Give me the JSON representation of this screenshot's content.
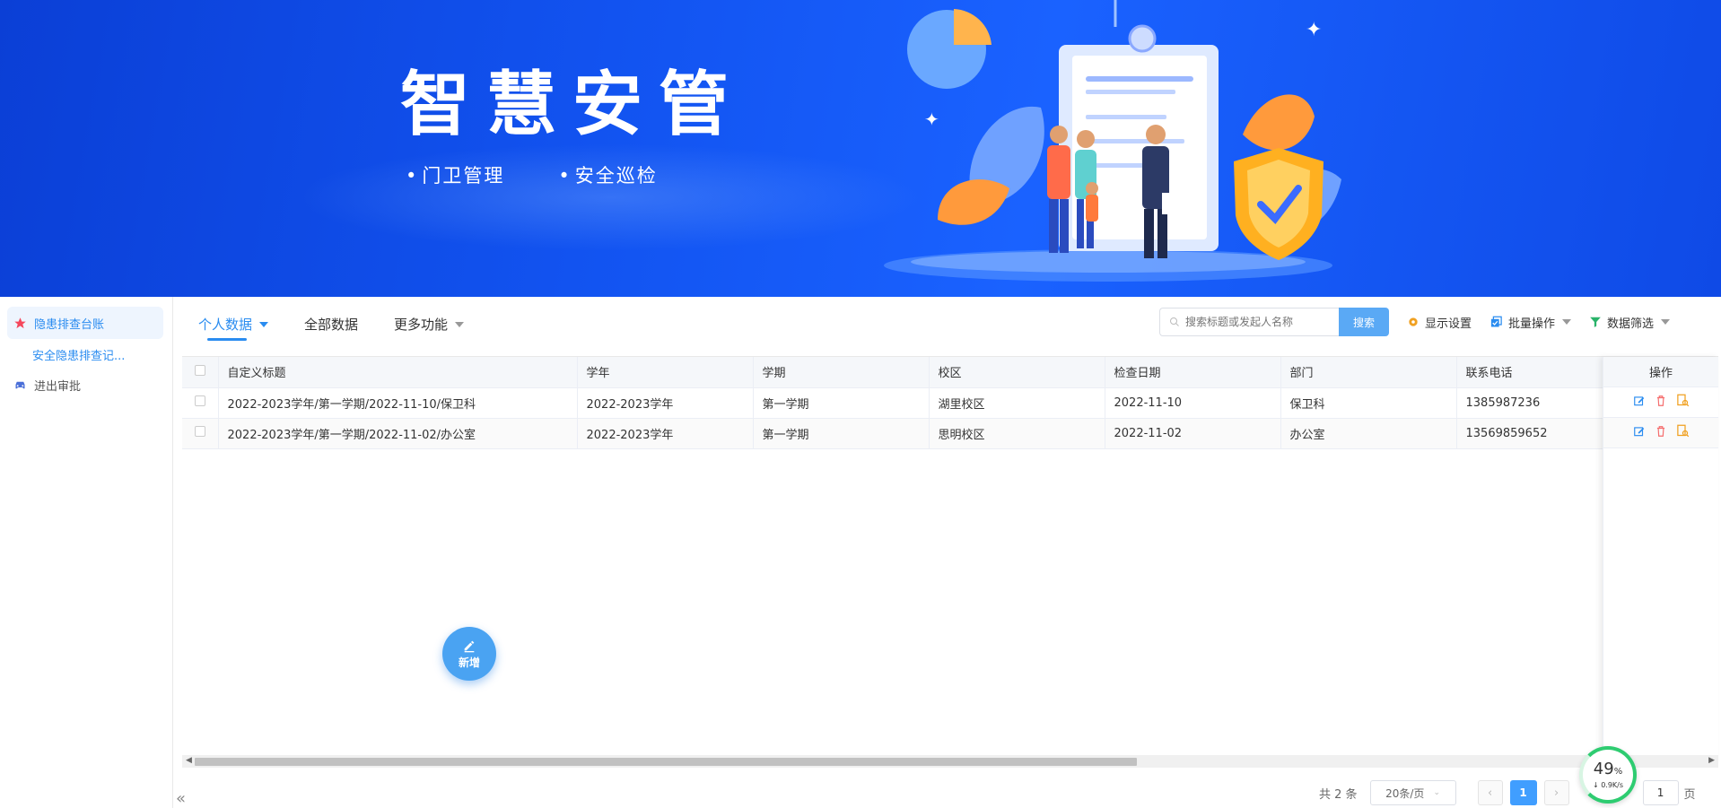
{
  "banner": {
    "title": "智慧安管",
    "subtitles": [
      "门卫管理",
      "安全巡检"
    ]
  },
  "sidebar": {
    "items": [
      {
        "label": "隐患排查台账",
        "icon": "star-icon",
        "active": true
      },
      {
        "label": "安全隐患排查记...",
        "sub": true
      },
      {
        "label": "进出审批",
        "icon": "car-icon"
      }
    ],
    "collapse_label": "«"
  },
  "tabs": [
    {
      "label": "个人数据",
      "active": true
    },
    {
      "label": "全部数据"
    },
    {
      "label": "更多功能"
    }
  ],
  "toolbar": {
    "search_placeholder": "搜索标题或发起人名称",
    "search_button": "搜索",
    "display_settings": "显示设置",
    "batch_ops": "批量操作",
    "data_filter": "数据筛选"
  },
  "table": {
    "columns": [
      "自定义标题",
      "学年",
      "学期",
      "校区",
      "检查日期",
      "部门",
      "联系电话"
    ],
    "ops_header": "操作",
    "rows": [
      [
        "2022-2023学年/第一学期/2022-11-10/保卫科",
        "2022-2023学年",
        "第一学期",
        "湖里校区",
        "2022-11-10",
        "保卫科",
        "1385987236"
      ],
      [
        "2022-2023学年/第一学期/2022-11-02/办公室",
        "2022-2023学年",
        "第一学期",
        "思明校区",
        "2022-11-02",
        "办公室",
        "13569859652"
      ]
    ]
  },
  "fab": {
    "label": "新增"
  },
  "pager": {
    "total": "共 2 条",
    "page_size": "20条/页",
    "current": "1",
    "jump_value": "1",
    "page_suffix": "页"
  },
  "net_widget": {
    "percent": "49",
    "percent_unit": "%",
    "speed": "0.9K/s",
    "progress": 0.49
  },
  "colors": {
    "accent": "#2a8cf0",
    "banner": "#1253f0",
    "danger": "#f56c6c",
    "warning": "#f0a020"
  }
}
